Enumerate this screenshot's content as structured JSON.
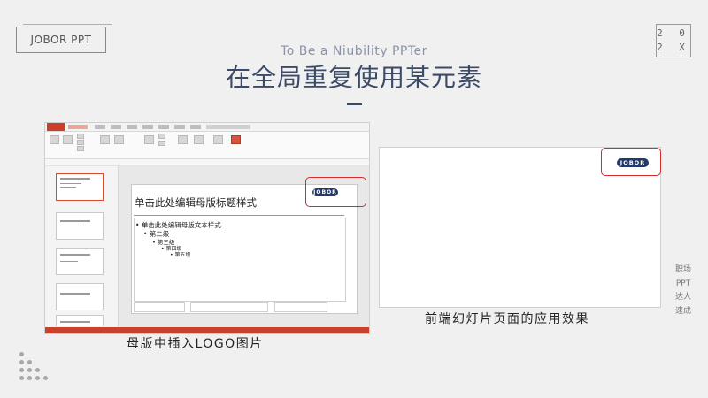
{
  "brand": {
    "badge_text": "JOBOR PPT"
  },
  "year": {
    "line1": "2 0",
    "line2": "2 X"
  },
  "header": {
    "subtitle": "To Be a Niubility PPTer",
    "title": "在全局重复使用某元素"
  },
  "side_text": "职场PPT达人速成",
  "left_panel": {
    "slide_title": "单击此处编辑母版标题样式",
    "levels": [
      "单击此处编辑母版文本样式",
      "第二级",
      "第三级",
      "第四级",
      "第五级"
    ],
    "logo_text": "JOBOR",
    "caption": "母版中插入LOGO图片"
  },
  "right_panel": {
    "logo_text": "JOBOR",
    "caption": "前端幻灯片页面的应用效果"
  },
  "colors": {
    "title": "#3b4a66",
    "accent_red": "#d62b2b",
    "logo_navy": "#223a6b",
    "ppt_orange": "#c9412b"
  }
}
